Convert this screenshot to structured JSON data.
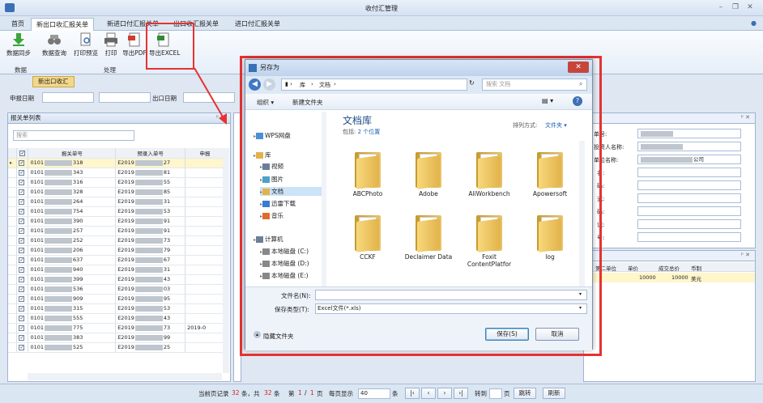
{
  "window": {
    "title": "收付汇管理"
  },
  "tabs": [
    "首页",
    "新出口收汇报关单",
    "新进口付汇报关单",
    "出口收汇报关单",
    "进口付汇报关单"
  ],
  "ribbon": {
    "buttons": [
      "数据同步",
      "数据查询",
      "打印预览",
      "打印",
      "导出PDF",
      "导出EXCEL"
    ],
    "groups": [
      "数据",
      "处理"
    ]
  },
  "subtab": "新出口收汇",
  "filter": {
    "declare_date_label": "申报日期",
    "export_date_label": "出口日期"
  },
  "left_panel": {
    "title": "报关单列表",
    "search_placeholder": "搜索",
    "columns": [
      "报关单号",
      "预录入单号",
      "申报"
    ],
    "rows": [
      {
        "a": "0101",
        "b": "318",
        "c": "E2019",
        "d": "27",
        "e": ""
      },
      {
        "a": "0101",
        "b": "343",
        "c": "E2019",
        "d": "81",
        "e": ""
      },
      {
        "a": "0101",
        "b": "316",
        "c": "E2019",
        "d": "55",
        "e": ""
      },
      {
        "a": "0101",
        "b": "328",
        "c": "E2019",
        "d": "85",
        "e": ""
      },
      {
        "a": "0101",
        "b": "264",
        "c": "E2019",
        "d": "31",
        "e": ""
      },
      {
        "a": "0101",
        "b": "754",
        "c": "E2019",
        "d": "53",
        "e": ""
      },
      {
        "a": "0101",
        "b": "390",
        "c": "E2019",
        "d": "91",
        "e": ""
      },
      {
        "a": "0101",
        "b": "257",
        "c": "E2019",
        "d": "91",
        "e": ""
      },
      {
        "a": "0101",
        "b": "252",
        "c": "E2019",
        "d": "73",
        "e": ""
      },
      {
        "a": "0101",
        "b": "206",
        "c": "E2019",
        "d": "79",
        "e": ""
      },
      {
        "a": "0101",
        "b": "637",
        "c": "E2019",
        "d": "67",
        "e": ""
      },
      {
        "a": "0101",
        "b": "940",
        "c": "E2019",
        "d": "31",
        "e": ""
      },
      {
        "a": "0101",
        "b": "399",
        "c": "E2019",
        "d": "43",
        "e": ""
      },
      {
        "a": "0101",
        "b": "536",
        "c": "E2019",
        "d": "03",
        "e": ""
      },
      {
        "a": "0101",
        "b": "909",
        "c": "E2019",
        "d": "95",
        "e": ""
      },
      {
        "a": "0101",
        "b": "315",
        "c": "E2019",
        "d": "53",
        "e": ""
      },
      {
        "a": "0101",
        "b": "555",
        "c": "E2019",
        "d": "43",
        "e": ""
      },
      {
        "a": "0101",
        "b": "775",
        "c": "E2019",
        "d": "73",
        "e": "2019-0"
      },
      {
        "a": "0101",
        "b": "383",
        "c": "E2019",
        "d": "99",
        "e": ""
      },
      {
        "a": "0101",
        "b": "525",
        "c": "E2019",
        "d": "25",
        "e": ""
      }
    ]
  },
  "right_panel": {
    "labels": [
      "单号:",
      "投资人名称:",
      "单位名称:",
      "名:",
      "码:",
      "式:",
      "码:",
      "记:",
      "号:"
    ],
    "values": [
      "",
      "",
      "公司",
      "",
      "",
      "",
      "",
      "",
      ""
    ],
    "grid_columns": [
      "第二单位",
      "单价",
      "成交总价",
      "币制"
    ],
    "grid_row": [
      "",
      "10000",
      "10000",
      "美元"
    ]
  },
  "status": {
    "prefix": "当前页记录",
    "current": "32",
    "mid": "条，共",
    "total": "32",
    "suffix": "条",
    "page_label": "第",
    "page": "1",
    "slash": "/",
    "pages": "1",
    "page_unit": "页",
    "per_page_label": "每页显示",
    "per_page": "40",
    "per_page_unit": "条",
    "goto_label": "转到",
    "goto_unit": "页",
    "jump": "跳转",
    "refresh": "刷新"
  },
  "dialog": {
    "title": "另存为",
    "breadcrumb": [
      "库",
      "文档"
    ],
    "search_placeholder": "搜索 文档",
    "organize": "组织 ▾",
    "new_folder": "新建文件夹",
    "nav": [
      "WPS网盘",
      "库",
      "视频",
      "图片",
      "文档",
      "迅雷下载",
      "音乐",
      "计算机",
      "本地磁盘 (C:)",
      "本地磁盘 (D:)",
      "本地磁盘 (E:)"
    ],
    "library_title": "文档库",
    "library_sub_prefix": "包括: ",
    "library_sub_link": "2 个位置",
    "sort_label": "排列方式:",
    "sort_value": "文件夹 ▾",
    "folders": [
      "ABCPhoto",
      "Adobe",
      "AliWorkbench",
      "Apowersoft",
      "CCKF",
      "Declaimer Data",
      "Foxit ContentPlatfor",
      "log"
    ],
    "filename_label": "文件名(N):",
    "filename_value": "",
    "filetype_label": "保存类型(T):",
    "filetype_value": "Excel文件(*.xls)",
    "hide_folders": "隐藏文件夹",
    "save": "保存(S)",
    "cancel": "取消"
  },
  "colors": {
    "accent_red": "#e63232",
    "status_red": "#d42020",
    "folder": "#e9c46a"
  }
}
